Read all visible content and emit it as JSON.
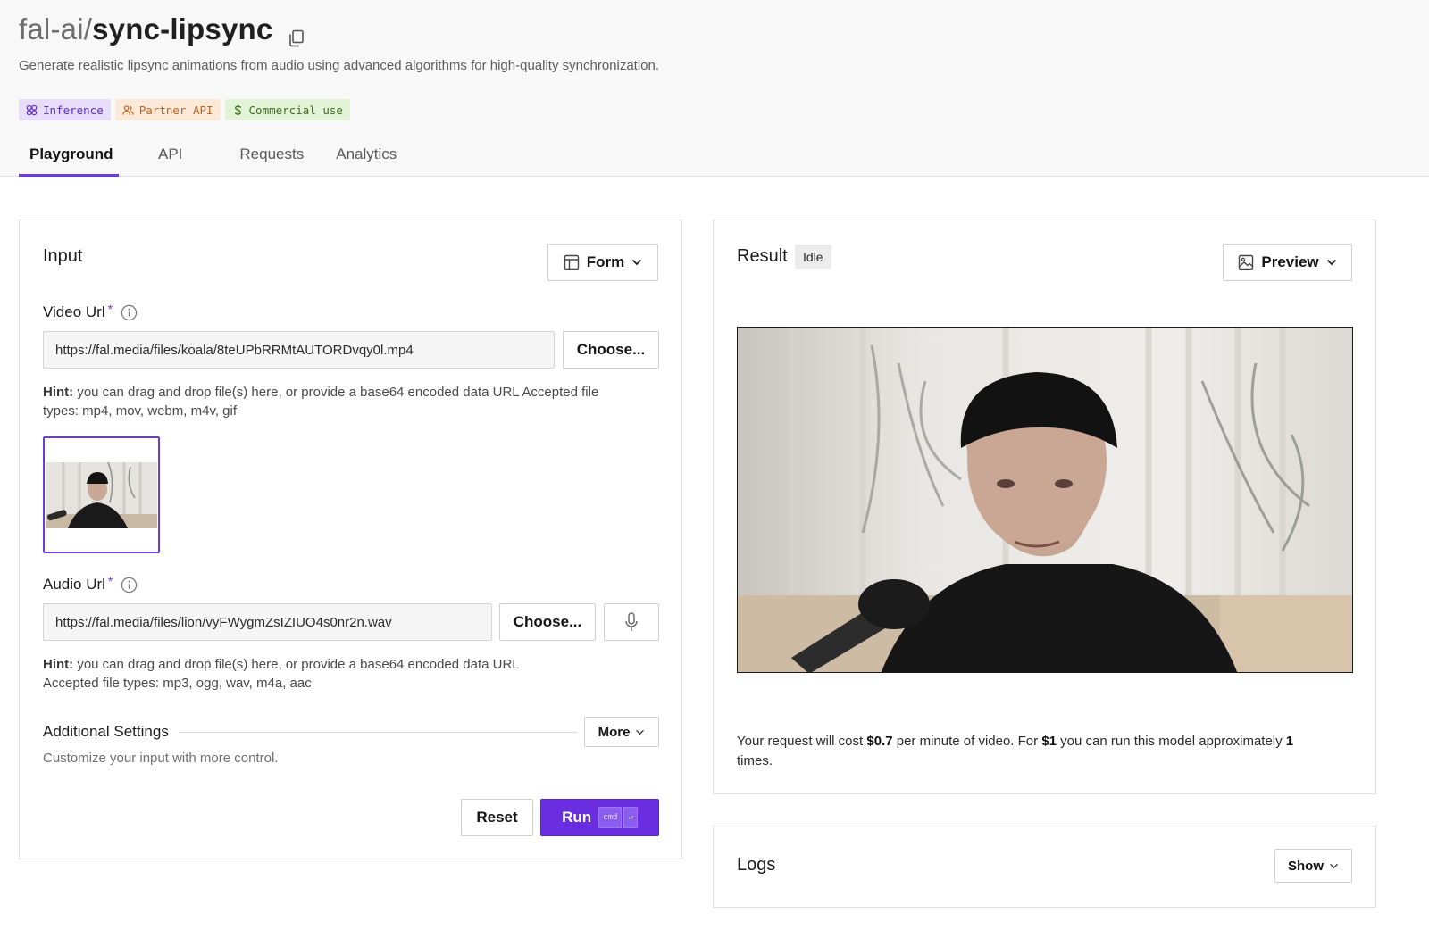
{
  "header": {
    "namespace": "fal-ai/",
    "model_name": "sync-lipsync",
    "subtitle": "Generate realistic lipsync animations from audio using advanced algorithms for high-quality synchronization.",
    "badges": [
      {
        "label": "Inference",
        "icon": "inference-icon"
      },
      {
        "label": "Partner API",
        "icon": "users-icon"
      },
      {
        "label": "Commercial use",
        "icon": "dollar-icon"
      }
    ]
  },
  "tabs": [
    {
      "label": "Playground",
      "active": true
    },
    {
      "label": "API",
      "active": false
    },
    {
      "label": "Requests",
      "active": false
    },
    {
      "label": "Analytics",
      "active": false
    }
  ],
  "input": {
    "title": "Input",
    "mode_button": "Form",
    "video_url": {
      "label": "Video Url",
      "required_mark": "*",
      "value": "https://fal.media/files/koala/8teUPbRRMtAUTORDvqy0l.mp4",
      "choose_label": "Choose...",
      "hint_bold": "Hint:",
      "hint_line1": " you can drag and drop file(s) here, or provide a base64 encoded data URL Accepted file",
      "hint_line2": "types: mp4, mov, webm, m4v, gif"
    },
    "audio_url": {
      "label": "Audio Url",
      "required_mark": "*",
      "value": "https://fal.media/files/lion/vyFWygmZsIZIUO4s0nr2n.wav",
      "choose_label": "Choose...",
      "hint_bold": "Hint:",
      "hint_line1": " you can drag and drop file(s) here, or provide a base64 encoded data URL",
      "hint_line2": "Accepted file types: mp3, ogg, wav, m4a, aac"
    },
    "additional_settings": {
      "label": "Additional Settings",
      "more_label": "More",
      "description": "Customize your input with more control."
    },
    "reset_label": "Reset",
    "run_label": "Run",
    "run_shortcut": [
      "cmd",
      "↵"
    ]
  },
  "result": {
    "title": "Result",
    "status": "Idle",
    "preview_button": "Preview",
    "cost": {
      "prefix": "Your request will cost ",
      "price": "$0.7",
      "middle": " per minute of video. For ",
      "budget": "$1",
      "suffix": " you can run this model approximately ",
      "runs": "1",
      "end": "times."
    }
  },
  "logs": {
    "title": "Logs",
    "show_label": "Show"
  },
  "colors": {
    "accent": "#6a2ee0",
    "inference_badge_bg": "#e7ddfb",
    "partner_badge_bg": "#fde9d8",
    "commercial_badge_bg": "#e2f3d7"
  }
}
